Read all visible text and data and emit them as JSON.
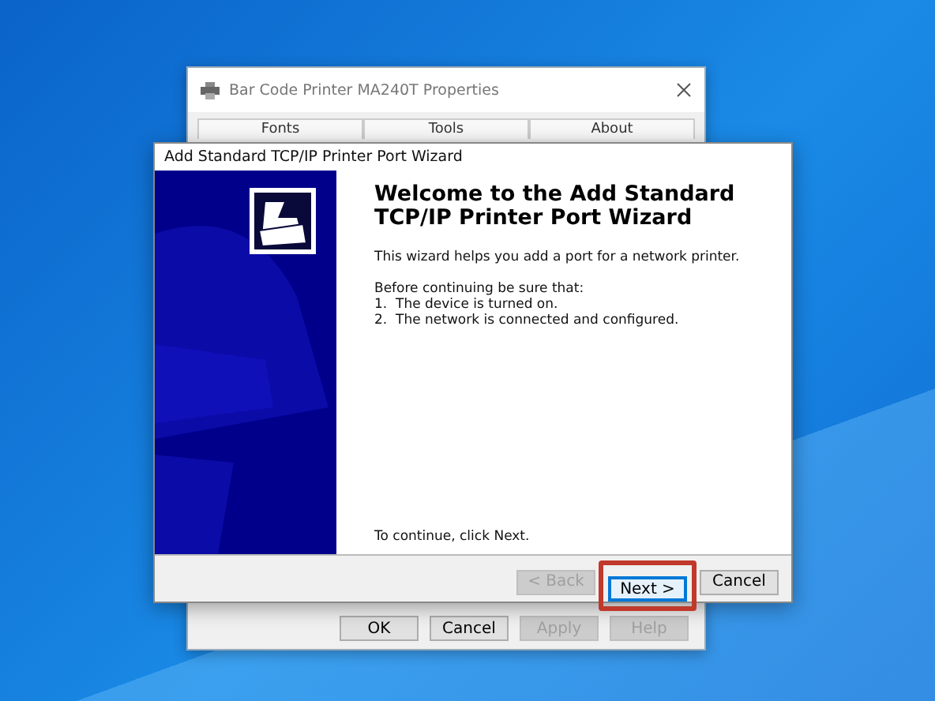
{
  "back_window": {
    "title": "Bar Code Printer MA240T Properties",
    "tabs": [
      {
        "label": "Fonts"
      },
      {
        "label": "Tools"
      },
      {
        "label": "About"
      }
    ],
    "buttons": [
      {
        "label": "OK",
        "disabled": false
      },
      {
        "label": "Cancel",
        "disabled": false
      },
      {
        "label": "Apply",
        "disabled": true
      },
      {
        "label": "Help",
        "disabled": true
      }
    ]
  },
  "wizard": {
    "title": "Add Standard TCP/IP Printer Port Wizard",
    "heading": "Welcome to the Add Standard TCP/IP Printer Port Wizard",
    "intro": "This wizard helps you add a port for a network printer.",
    "checklist_title": "Before continuing be sure that:",
    "checklist": [
      "1.  The device is turned on.",
      "2.  The network is connected and configured."
    ],
    "footer_text": "To continue, click Next.",
    "buttons": [
      {
        "label": "< Back",
        "disabled": true,
        "highlighted": false
      },
      {
        "label": "Next >",
        "disabled": false,
        "highlighted": true
      },
      {
        "label": "Cancel",
        "disabled": false,
        "highlighted": false
      }
    ]
  }
}
